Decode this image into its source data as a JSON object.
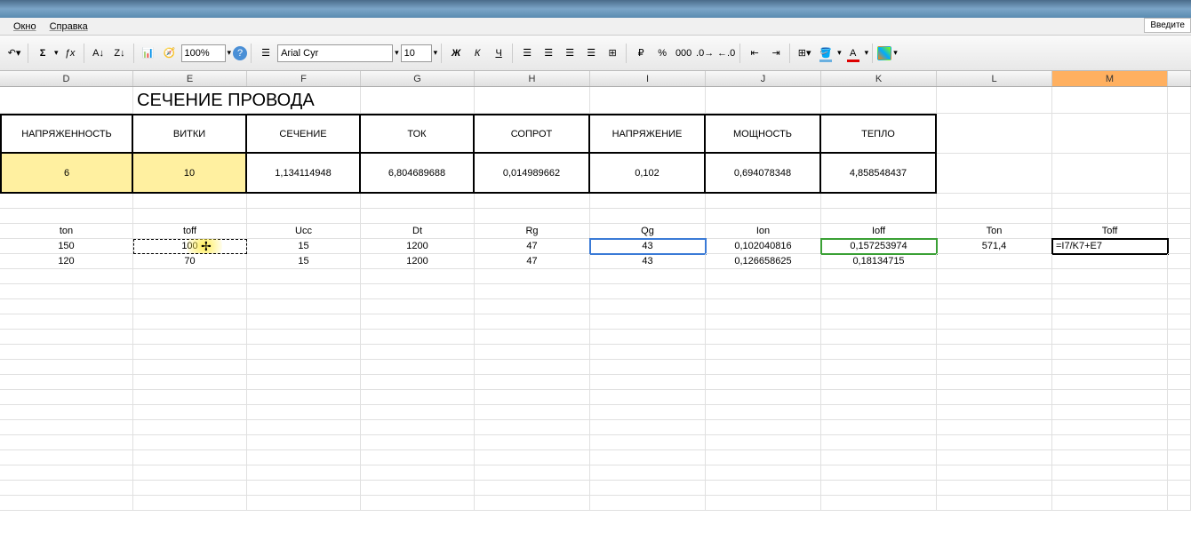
{
  "menu": {
    "window": "Окно",
    "help": "Справка"
  },
  "inputHelp": "Введите",
  "toolbar": {
    "zoom": "100%",
    "font": "Arial Cyr",
    "size": "10"
  },
  "columns": [
    "D",
    "E",
    "F",
    "G",
    "H",
    "I",
    "J",
    "K",
    "L",
    "M"
  ],
  "sectionTitle": "СЕЧЕНИЕ ПРОВОДА",
  "boxHeaders": {
    "D": "НАПРЯЖЕННОСТЬ",
    "E": "ВИТКИ",
    "F": "СЕЧЕНИЕ",
    "G": "ТОК",
    "H": "СОПРОТ",
    "I": "НАПРЯЖЕНИЕ",
    "J": "МОЩНОСТЬ",
    "K": "ТЕПЛО"
  },
  "boxValues": {
    "D": "6",
    "E": "10",
    "F": "1,134114948",
    "G": "6,804689688",
    "H": "0,014989662",
    "I": "0,102",
    "J": "0,694078348",
    "K": "4,858548437"
  },
  "paramHeaders": {
    "D": "ton",
    "E": "toff",
    "F": "Ucc",
    "G": "Dt",
    "H": "Rg",
    "I": "Qg",
    "J": "Ion",
    "K": "Ioff",
    "L": "Ton",
    "M": "Toff"
  },
  "paramRow1": {
    "D": "150",
    "E": "100",
    "F": "15",
    "G": "1200",
    "H": "47",
    "I": "43",
    "J": "0,102040816",
    "K": "0,157253974",
    "L": "571,4",
    "M": "=I7/K7+E7"
  },
  "paramRow2": {
    "D": "120",
    "E": "70",
    "F": "15",
    "G": "1200",
    "H": "47",
    "I": "43",
    "J": "0,126658625",
    "K": "0,18134715",
    "L": "",
    "M": ""
  }
}
